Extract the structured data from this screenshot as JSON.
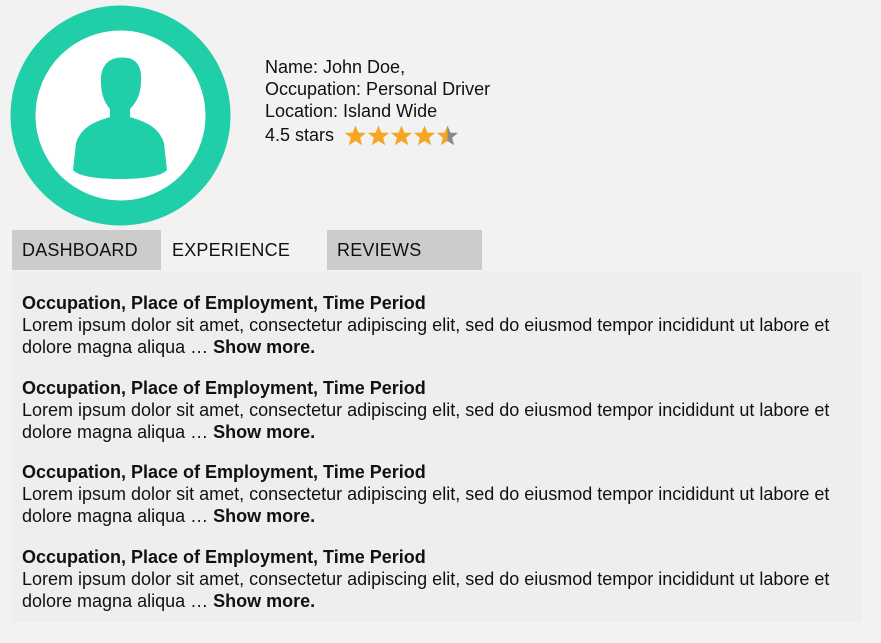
{
  "profile": {
    "name_line": "Name: John Doe,",
    "occupation_line": "Occupation: Personal Driver",
    "location_line": "Location: Island Wide",
    "rating_text": "4.5 stars",
    "rating_value": 4.5,
    "rating_max": 5,
    "avatar_color": "#20cfa7",
    "star_color": "#f6a623",
    "star_empty_color": "#8a8a8a"
  },
  "tabs": [
    {
      "label": "DASHBOARD",
      "active": false
    },
    {
      "label": "EXPERIENCE",
      "active": true
    },
    {
      "label": "REVIEWS",
      "active": false
    }
  ],
  "experience": [
    {
      "title": "Occupation, Place of Employment, Time Period",
      "text": "Lorem ipsum dolor sit amet, consectetur adipiscing elit, sed do eiusmod tempor incididunt ut labore et dolore magna aliqua … ",
      "more": "Show more."
    },
    {
      "title": "Occupation, Place of Employment, Time Period",
      "text": "Lorem ipsum dolor sit amet, consectetur adipiscing elit, sed do eiusmod tempor incididunt ut labore et dolore magna aliqua … ",
      "more": "Show more."
    },
    {
      "title": "Occupation, Place of Employment, Time Period",
      "text": "Lorem ipsum dolor sit amet, consectetur adipiscing elit, sed do eiusmod tempor incididunt ut labore et dolore magna aliqua … ",
      "more": "Show more."
    },
    {
      "title": "Occupation, Place of Employment, Time Period",
      "text": "Lorem ipsum dolor sit amet, consectetur adipiscing elit, sed do eiusmod tempor incididunt ut labore et dolore magna aliqua … ",
      "more": "Show more."
    }
  ]
}
